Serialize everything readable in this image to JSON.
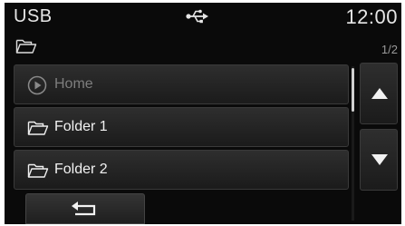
{
  "status_bar": {
    "source": "USB",
    "connection_icon": "usb-icon",
    "clock": "12:00"
  },
  "folder_bar": {
    "icon": "folder-open-icon",
    "page_indicator": "1/2"
  },
  "list": {
    "items": [
      {
        "label": "Home",
        "icon": "play-circle-icon",
        "enabled": false
      },
      {
        "label": "Folder 1",
        "icon": "folder-open-icon",
        "enabled": true
      },
      {
        "label": "Folder 2",
        "icon": "folder-open-icon",
        "enabled": true
      }
    ]
  },
  "scroll": {
    "up_icon": "triangle-up-icon",
    "down_icon": "triangle-down-icon",
    "position": 0.0,
    "visible_fraction": 0.5
  },
  "back": {
    "icon": "back-arrow-icon"
  },
  "colors": {
    "background": "#0a0a0a",
    "text": "#f2f2f2",
    "disabled_text": "#7e7e7e",
    "button_top": "#2e2e2e",
    "button_bottom": "#1b1b1b"
  }
}
